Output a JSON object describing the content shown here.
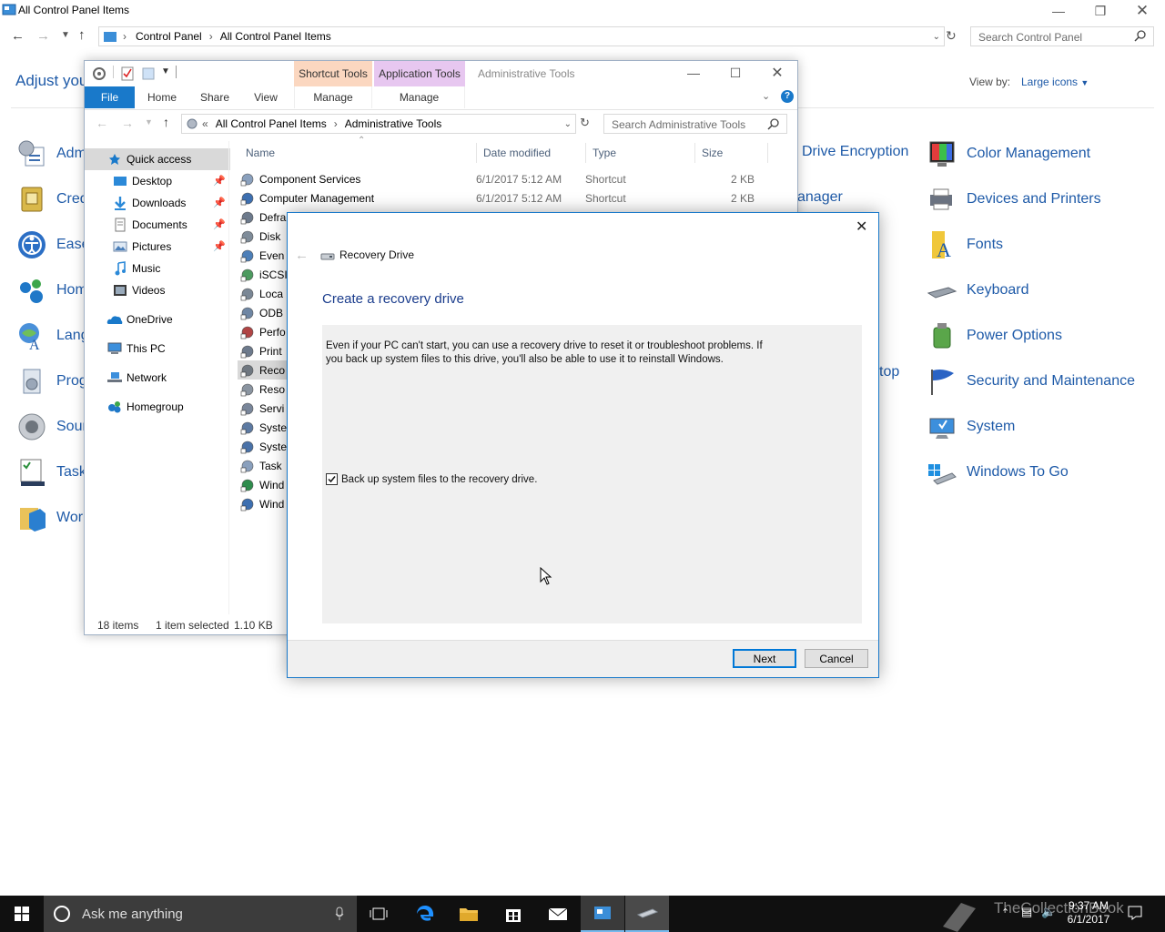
{
  "control_panel": {
    "title": "All Control Panel Items",
    "breadcrumb": [
      "Control Panel",
      "All Control Panel Items"
    ],
    "search_placeholder": "Search Control Panel",
    "heading": "Adjust you",
    "view_by_label": "View by:",
    "view_by_value": "Large icons",
    "col1_items": [
      {
        "label": "Adm",
        "icon": "admin-tools-icon"
      },
      {
        "label": "Cred",
        "icon": "credential-manager-icon"
      },
      {
        "label": "Ease",
        "icon": "ease-of-access-icon"
      },
      {
        "label": "Hom",
        "icon": "homegroup-icon"
      },
      {
        "label": "Lang",
        "icon": "language-icon"
      },
      {
        "label": "Prog",
        "icon": "programs-icon"
      },
      {
        "label": "Sour",
        "icon": "sound-icon"
      },
      {
        "label": "Task",
        "icon": "taskbar-icon"
      },
      {
        "label": "Wor",
        "icon": "work-folders-icon"
      }
    ],
    "col3_fragments": [
      "Drive Encryption",
      "anager",
      "top"
    ],
    "col4_items": [
      {
        "label": "Color Management",
        "icon": "color-management-icon"
      },
      {
        "label": "Devices and Printers",
        "icon": "devices-printers-icon"
      },
      {
        "label": "Fonts",
        "icon": "fonts-icon"
      },
      {
        "label": "Keyboard",
        "icon": "keyboard-icon"
      },
      {
        "label": "Power Options",
        "icon": "power-options-icon"
      },
      {
        "label": "Security and Maintenance",
        "icon": "security-flag-icon"
      },
      {
        "label": "System",
        "icon": "system-icon"
      },
      {
        "label": "Windows To Go",
        "icon": "windows-to-go-icon"
      }
    ]
  },
  "explorer": {
    "window_title": "Administrative Tools",
    "context_tabs": [
      {
        "label": "Shortcut Tools",
        "sub": "Manage",
        "color": "#fbd7c0"
      },
      {
        "label": "Application Tools",
        "sub": "Manage",
        "color": "#e7c7f0"
      }
    ],
    "ribbon_tabs": [
      "File",
      "Home",
      "Share",
      "View"
    ],
    "breadcrumb_prefix": "«",
    "breadcrumb": [
      "All Control Panel Items",
      "Administrative Tools"
    ],
    "search_placeholder": "Search Administrative Tools",
    "nav": [
      {
        "label": "Quick access",
        "icon": "star-icon",
        "pinned": false,
        "level": 0
      },
      {
        "label": "Desktop",
        "icon": "desktop-folder-icon",
        "pinned": true,
        "level": 1
      },
      {
        "label": "Downloads",
        "icon": "downloads-icon",
        "pinned": true,
        "level": 1
      },
      {
        "label": "Documents",
        "icon": "documents-icon",
        "pinned": true,
        "level": 1
      },
      {
        "label": "Pictures",
        "icon": "pictures-icon",
        "pinned": true,
        "level": 1
      },
      {
        "label": "Music",
        "icon": "music-icon",
        "pinned": false,
        "level": 1
      },
      {
        "label": "Videos",
        "icon": "videos-icon",
        "pinned": false,
        "level": 1
      },
      {
        "label": "OneDrive",
        "icon": "onedrive-icon",
        "pinned": false,
        "level": 0
      },
      {
        "label": "This PC",
        "icon": "this-pc-icon",
        "pinned": false,
        "level": 0
      },
      {
        "label": "Network",
        "icon": "network-icon",
        "pinned": false,
        "level": 0
      },
      {
        "label": "Homegroup",
        "icon": "homegroup-icon",
        "pinned": false,
        "level": 0
      }
    ],
    "columns": [
      "Name",
      "Date modified",
      "Type",
      "Size"
    ],
    "files": [
      {
        "name": "Component Services",
        "date": "6/1/2017 5:12 AM",
        "type": "Shortcut",
        "size": "2 KB"
      },
      {
        "name": "Computer Management",
        "date": "6/1/2017 5:12 AM",
        "type": "Shortcut",
        "size": "2 KB"
      },
      {
        "name": "Defra",
        "date": "",
        "type": "",
        "size": ""
      },
      {
        "name": "Disk",
        "date": "",
        "type": "",
        "size": ""
      },
      {
        "name": "Even",
        "date": "",
        "type": "",
        "size": ""
      },
      {
        "name": "iSCSI",
        "date": "",
        "type": "",
        "size": ""
      },
      {
        "name": "Loca",
        "date": "",
        "type": "",
        "size": ""
      },
      {
        "name": "ODB",
        "date": "",
        "type": "",
        "size": ""
      },
      {
        "name": "Perfo",
        "date": "",
        "type": "",
        "size": ""
      },
      {
        "name": "Print",
        "date": "",
        "type": "",
        "size": ""
      },
      {
        "name": "Reco",
        "date": "",
        "type": "",
        "size": "",
        "selected": true
      },
      {
        "name": "Reso",
        "date": "",
        "type": "",
        "size": ""
      },
      {
        "name": "Servi",
        "date": "",
        "type": "",
        "size": ""
      },
      {
        "name": "Syste",
        "date": "",
        "type": "",
        "size": ""
      },
      {
        "name": "Syste",
        "date": "",
        "type": "",
        "size": ""
      },
      {
        "name": "Task",
        "date": "",
        "type": "",
        "size": ""
      },
      {
        "name": "Wind",
        "date": "",
        "type": "",
        "size": ""
      },
      {
        "name": "Wind",
        "date": "",
        "type": "",
        "size": ""
      }
    ],
    "status": {
      "count": "18 items",
      "selection": "1 item selected",
      "size": "1.10 KB"
    }
  },
  "dialog": {
    "app_name": "Recovery Drive",
    "heading": "Create a recovery drive",
    "body": "Even if your PC can't start, you can use a recovery drive to reset it or troubleshoot problems. If you back up system files to this drive, you'll also be able to use it to reinstall Windows.",
    "checkbox_label": "Back up system files to the recovery drive.",
    "checkbox_checked": true,
    "next_label": "Next",
    "cancel_label": "Cancel"
  },
  "taskbar": {
    "search_placeholder": "Ask me anything",
    "clock_time": "9:37 AM",
    "clock_date": "6/1/2017",
    "watermark": "TheCollectionBook"
  },
  "colors": {
    "accent": "#0078d7",
    "link": "#1e5aa8",
    "taskbar": "#101010"
  }
}
